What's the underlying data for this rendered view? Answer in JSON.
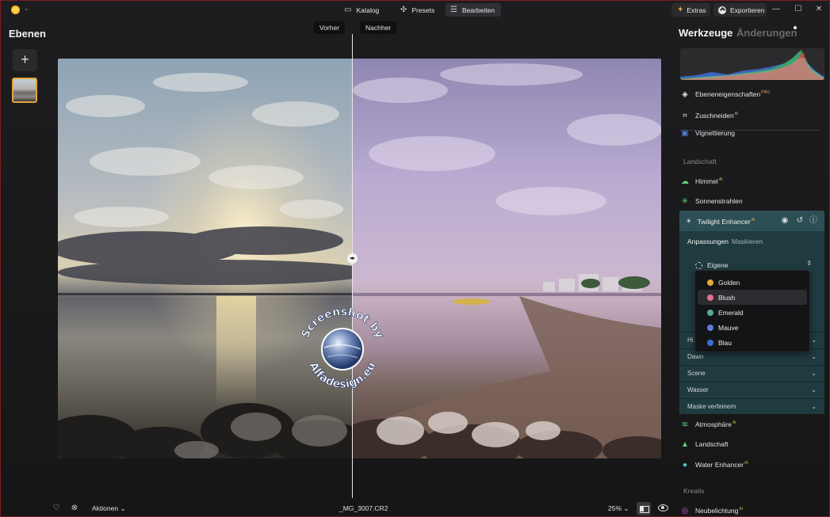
{
  "topbar": {
    "tabs": [
      {
        "label": "Katalog",
        "icon": "folder-icon"
      },
      {
        "label": "Presets",
        "icon": "sparkle-icon"
      },
      {
        "label": "Bearbeiten",
        "icon": "sliders-icon"
      }
    ],
    "active_tab": "Bearbeiten",
    "extras_label": "Extras",
    "export_label": "Exportieren",
    "window_controls": [
      "minimize-icon",
      "maximize-icon",
      "close-icon"
    ]
  },
  "layers": {
    "title": "Ebenen",
    "add_icon": "plus-icon"
  },
  "compare": {
    "before_label": "Vorher",
    "after_label": "Nachher"
  },
  "watermark": {
    "top_text": "Screenshot by",
    "bottom_text": "Alfadesign.eu"
  },
  "bottom": {
    "actions_label": "Aktionen",
    "filename": "_MG_3007.CR2",
    "zoom": "25%"
  },
  "tools": {
    "title": "Werkzeuge",
    "changes_title": "Änderungen",
    "items_top": [
      {
        "label": "Ebeneneigenschaften",
        "badge": "PRO",
        "icon": "layers-icon"
      },
      {
        "label": "Zuschneiden",
        "badge": "AI",
        "icon": "crop-icon"
      },
      {
        "label": "Vignettierung",
        "badge": "",
        "icon": "vignette-icon"
      }
    ],
    "section_landscape": "Landschaft",
    "items_landscape": [
      {
        "label": "Himmel",
        "badge": "AI",
        "icon": "cloud-icon"
      },
      {
        "label": "Sonnenstrahlen",
        "badge": "",
        "icon": "sun-icon"
      }
    ],
    "twilight": {
      "title": "Twilight Enhancer",
      "badge": "AI",
      "subtabs": [
        "Anpassungen",
        "Maskieren"
      ],
      "preset_value": "Eigene",
      "accordion": [
        "Hi...",
        "Dawn",
        "Scene",
        "Wasser",
        "Maske verfeinern"
      ]
    },
    "dropdown_options": [
      {
        "label": "Golden",
        "color": "#e7a93b"
      },
      {
        "label": "Blush",
        "color": "#e0708f"
      },
      {
        "label": "Emerald",
        "color": "#58a89a"
      },
      {
        "label": "Mauve",
        "color": "#5f7fe0"
      },
      {
        "label": "Blau",
        "color": "#3d6fd8"
      }
    ],
    "dropdown_selected": "Blush",
    "items_after": [
      {
        "label": "Atmosphäre",
        "badge": "AI",
        "icon": "haze-icon"
      },
      {
        "label": "Landschaft",
        "badge": "",
        "icon": "landscape-icon"
      },
      {
        "label": "Water Enhancer",
        "badge": "AI",
        "icon": "droplet-icon"
      }
    ],
    "section_creative": "Kreativ",
    "items_creative": [
      {
        "label": "Neubelichtung",
        "badge": "AI",
        "icon": "relight-icon"
      }
    ]
  },
  "colors": {
    "accent": "#e0a640",
    "panel_teal": "#1f3b40",
    "panel_teal_head": "#2c4f55",
    "window_border": "#7a1e22"
  }
}
